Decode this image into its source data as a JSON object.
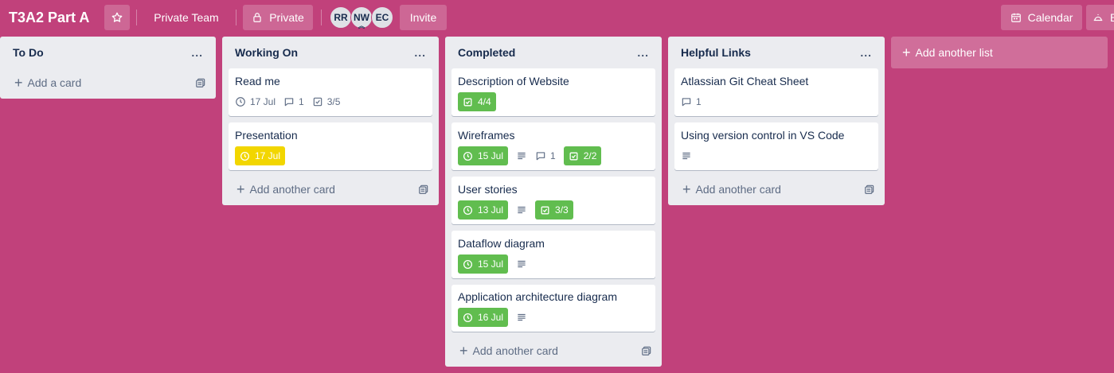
{
  "header": {
    "board_title": "T3A2 Part A",
    "team_label": "Private Team",
    "visibility_label": "Private",
    "members": [
      {
        "initials": "RR"
      },
      {
        "initials": "NW"
      },
      {
        "initials": "EC"
      }
    ],
    "invite_label": "Invite",
    "calendar_label": "Calendar",
    "cutoff_label": "B"
  },
  "colors": {
    "board_bg": "#c1417b",
    "green_badge": "#61bd4f",
    "yellow_badge": "#f2d600"
  },
  "lists": [
    {
      "title": "To Do",
      "menu": "...",
      "cards": [],
      "footer": "Add a card"
    },
    {
      "title": "Working On",
      "menu": "...",
      "cards": [
        {
          "title": "Read me",
          "due": "17 Jul",
          "comments": "1",
          "checklist": "3/5"
        },
        {
          "title": "Presentation",
          "due": "17 Jul"
        }
      ],
      "footer": "Add another card"
    },
    {
      "title": "Completed",
      "menu": "...",
      "cards": [
        {
          "title": "Description of Website",
          "checklist": "4/4"
        },
        {
          "title": "Wireframes",
          "due": "15 Jul",
          "comments": "1",
          "checklist": "2/2"
        },
        {
          "title": "User stories",
          "due": "13 Jul",
          "checklist": "3/3"
        },
        {
          "title": "Dataflow diagram",
          "due": "15 Jul"
        },
        {
          "title": "Application architecture diagram",
          "due": "16 Jul"
        }
      ],
      "footer": "Add another card"
    },
    {
      "title": "Helpful Links",
      "menu": "...",
      "cards": [
        {
          "title": "Atlassian Git Cheat Sheet",
          "comments": "1"
        },
        {
          "title": "Using version control in VS Code"
        }
      ],
      "footer": "Add another card"
    }
  ],
  "add_list_label": "Add another list"
}
